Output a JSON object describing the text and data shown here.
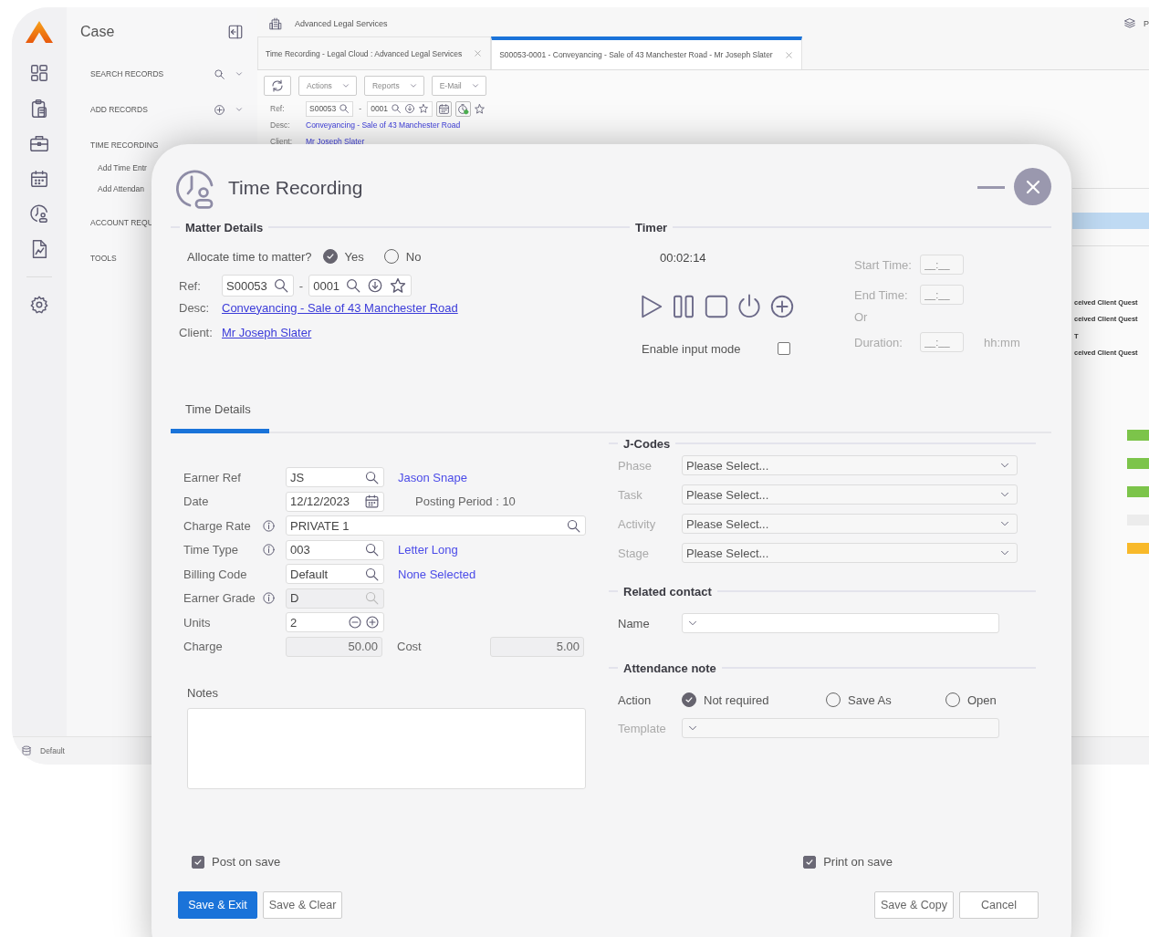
{
  "sidebar": {
    "title": "Case",
    "items": [
      {
        "label": "SEARCH RECORDS",
        "kind": "search"
      },
      {
        "label": "ADD RECORDS",
        "kind": "add"
      },
      {
        "label": "TIME RECORDING",
        "kind": "plain",
        "children": [
          {
            "label": "Add Time Entr"
          },
          {
            "label": "Add Attendan"
          }
        ]
      },
      {
        "label": "ACCOUNT REQU",
        "kind": "plain"
      },
      {
        "label": "TOOLS",
        "kind": "plain"
      }
    ]
  },
  "header": {
    "company": "Advanced Legal Services",
    "right_text": "P"
  },
  "tabs": [
    {
      "label": "Time Recording - Legal Cloud : Advanced Legal Services",
      "selected": false
    },
    {
      "label": "S00053-0001 - Conveyancing - Sale of 43 Manchester Road - Mr Joseph Slater",
      "selected": true
    }
  ],
  "case_view": {
    "menus": [
      "Actions",
      "Reports",
      "E-Mail"
    ],
    "ref_label": "Ref:",
    "ref": "S00053",
    "separator": "-",
    "sub_ref": "0001",
    "desc_label": "Desc:",
    "desc": "Conveyancing - Sale of 43 Manchester Road",
    "client_label": "Client:",
    "client": "Mr Joseph Slater"
  },
  "side_panel": {
    "rows": [
      "ceived Client Quest",
      "ceived Client Quest",
      "T",
      "ceived Client Quest"
    ],
    "status_blocks": [
      {
        "color": "#7cc44a"
      },
      {
        "color": "#7cc44a"
      },
      {
        "color": "#7cc44a"
      },
      {
        "color": "#ececec"
      },
      {
        "color": "#f8b92a"
      }
    ]
  },
  "footer": {
    "label": "Default"
  },
  "dialog": {
    "title": "Time Recording",
    "matter_details": {
      "heading": "Matter Details",
      "allocate": {
        "label": "Allocate time to matter?",
        "options": [
          {
            "label": "Yes",
            "selected": true
          },
          {
            "label": "No",
            "selected": false
          }
        ]
      },
      "ref_label": "Ref:",
      "ref": "S00053",
      "separator": "-",
      "sub_ref": "0001",
      "desc_label": "Desc:",
      "desc": "Conveyancing - Sale of 43 Manchester Road",
      "client_label": "Client:",
      "client": "Mr Joseph Slater"
    },
    "timer": {
      "heading": "Timer",
      "elapsed": "00:02:14",
      "input_mode": {
        "label": "Enable input mode",
        "checked": false
      },
      "fields": [
        {
          "label": "Start Time:",
          "placeholder": "__:__"
        },
        {
          "label": "End Time:",
          "placeholder": "__:__"
        }
      ],
      "or": "Or",
      "duration": {
        "label": "Duration:",
        "placeholder": "__:__",
        "unit": "hh:mm"
      }
    },
    "tabs": [
      {
        "label": "Time Details",
        "selected": true
      }
    ],
    "fields": [
      {
        "label": "Earner Ref",
        "info": false,
        "disabled": false,
        "kind": "lookup",
        "value": "JS",
        "link": "Jason Snape"
      },
      {
        "label": "Date",
        "info": false,
        "disabled": false,
        "kind": "date",
        "value": "12/12/2023",
        "note": "Posting Period : 10"
      },
      {
        "label": "Charge Rate",
        "info": true,
        "disabled": false,
        "kind": "wide",
        "value": "PRIVATE 1"
      },
      {
        "label": "Time Type",
        "info": true,
        "disabled": false,
        "kind": "lookup",
        "value": "003",
        "link": "Letter Long"
      },
      {
        "label": "Billing Code",
        "info": false,
        "disabled": false,
        "kind": "lookup",
        "value": "Default",
        "link": "None Selected"
      },
      {
        "label": "Earner Grade",
        "info": true,
        "disabled": true,
        "kind": "lookup",
        "value": "D"
      },
      {
        "label": "Units",
        "info": false,
        "disabled": false,
        "kind": "stepper",
        "value": "2"
      },
      {
        "label": "Charge",
        "info": false,
        "disabled": true,
        "kind": "amount",
        "value": "50.00",
        "extra_label": "Cost",
        "extra_value": "5.00"
      }
    ],
    "notes_label": "Notes",
    "jcodes": {
      "heading": "J-Codes",
      "rows": [
        {
          "label": "Phase",
          "value": "Please Select..."
        },
        {
          "label": "Task",
          "value": "Please Select..."
        },
        {
          "label": "Activity",
          "value": "Please Select..."
        },
        {
          "label": "Stage",
          "value": "Please Select..."
        }
      ]
    },
    "related_contact": {
      "heading": "Related contact",
      "label": "Name"
    },
    "attendance": {
      "heading": "Attendance note",
      "action_label": "Action",
      "options": [
        {
          "label": "Not required",
          "selected": true
        },
        {
          "label": "Save As",
          "selected": false
        },
        {
          "label": "Open",
          "selected": false
        }
      ],
      "template_label": "Template"
    },
    "checks": [
      {
        "label": "Post on save",
        "checked": true
      },
      {
        "label": "Print on save",
        "checked": true
      }
    ],
    "buttons": [
      {
        "label": "Save & Exit",
        "kind": "primary"
      },
      {
        "label": "Save & Clear",
        "kind": "secondary"
      },
      {
        "label": "Save & Copy",
        "kind": "secondary"
      },
      {
        "label": "Cancel",
        "kind": "secondary"
      }
    ]
  }
}
